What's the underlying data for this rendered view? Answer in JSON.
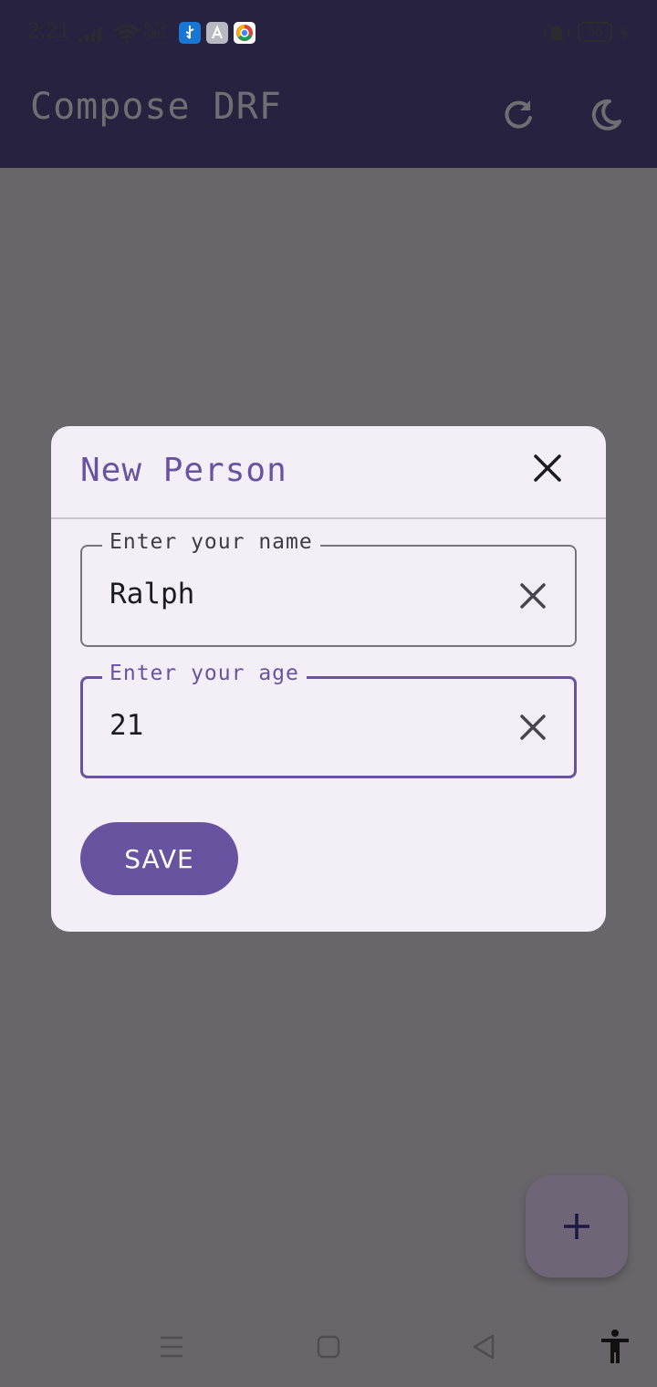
{
  "status_bar": {
    "time": "2:21",
    "net_speed_value": "0.71",
    "net_speed_unit": "KB/S",
    "battery_level": "56",
    "icons": [
      "signal-icon",
      "wifi-icon",
      "usb-icon",
      "app-store-icon",
      "chrome-icon",
      "vibrate-icon",
      "battery-icon",
      "charging-icon"
    ]
  },
  "app_bar": {
    "title": "Compose DRF",
    "actions": [
      "refresh-icon",
      "dark-mode-icon"
    ]
  },
  "dialog": {
    "title": "New Person",
    "close_icon": "close-icon",
    "fields": [
      {
        "label": "Enter your name",
        "value": "Ralph",
        "focused": false
      },
      {
        "label": "Enter your age",
        "value": "21",
        "focused": true
      }
    ],
    "save_label": "SAVE"
  },
  "fab": {
    "icon": "plus-icon"
  },
  "nav_bar": {
    "icons": [
      "menu-icon",
      "home-icon",
      "back-icon",
      "accessibility-icon"
    ]
  },
  "colors": {
    "primary": "#67539f",
    "app_bar": "#272240",
    "dialog_surface": "#f4eff6",
    "scrim": "#68666b"
  }
}
